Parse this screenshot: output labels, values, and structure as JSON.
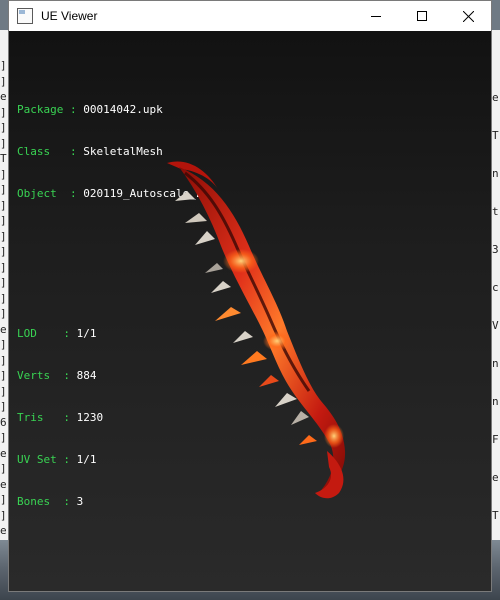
{
  "window": {
    "title": "UE Viewer",
    "controls": {
      "minimize": "minimize",
      "maximize": "maximize",
      "close": "close"
    }
  },
  "info": {
    "object_rows": [
      {
        "label": "Package",
        "value": "00014042.upk"
      },
      {
        "label": "Class",
        "value": "SkeletalMesh"
      },
      {
        "label": "Object",
        "value": "020119_Autoscale_L"
      }
    ],
    "stats_rows": [
      {
        "label": "LOD",
        "value": "1/1"
      },
      {
        "label": "Verts",
        "value": "884"
      },
      {
        "label": "Tris",
        "value": "1230"
      },
      {
        "label": "UV Set",
        "value": "1/1"
      },
      {
        "label": "Bones",
        "value": "3"
      }
    ]
  },
  "background_left_chars": [
    "]",
    "]",
    "e",
    "]",
    "]",
    "]",
    "T",
    "]",
    "]",
    "]",
    "]",
    "]",
    "]",
    "]",
    "]",
    "]",
    "]",
    "e",
    "]",
    "]",
    "]",
    "]",
    "]",
    "6",
    "]",
    "e",
    "]",
    "e",
    "]",
    "]",
    "e",
    "]"
  ],
  "background_right_chars": [
    "e",
    "T",
    "n",
    "t",
    "3",
    "c",
    "V",
    "n",
    "n",
    "F",
    "e",
    "T"
  ],
  "colors": {
    "label": "#39d353",
    "value": "#ffffff",
    "blade_red": "#c41a10",
    "blade_orange": "#ff6a1a"
  }
}
